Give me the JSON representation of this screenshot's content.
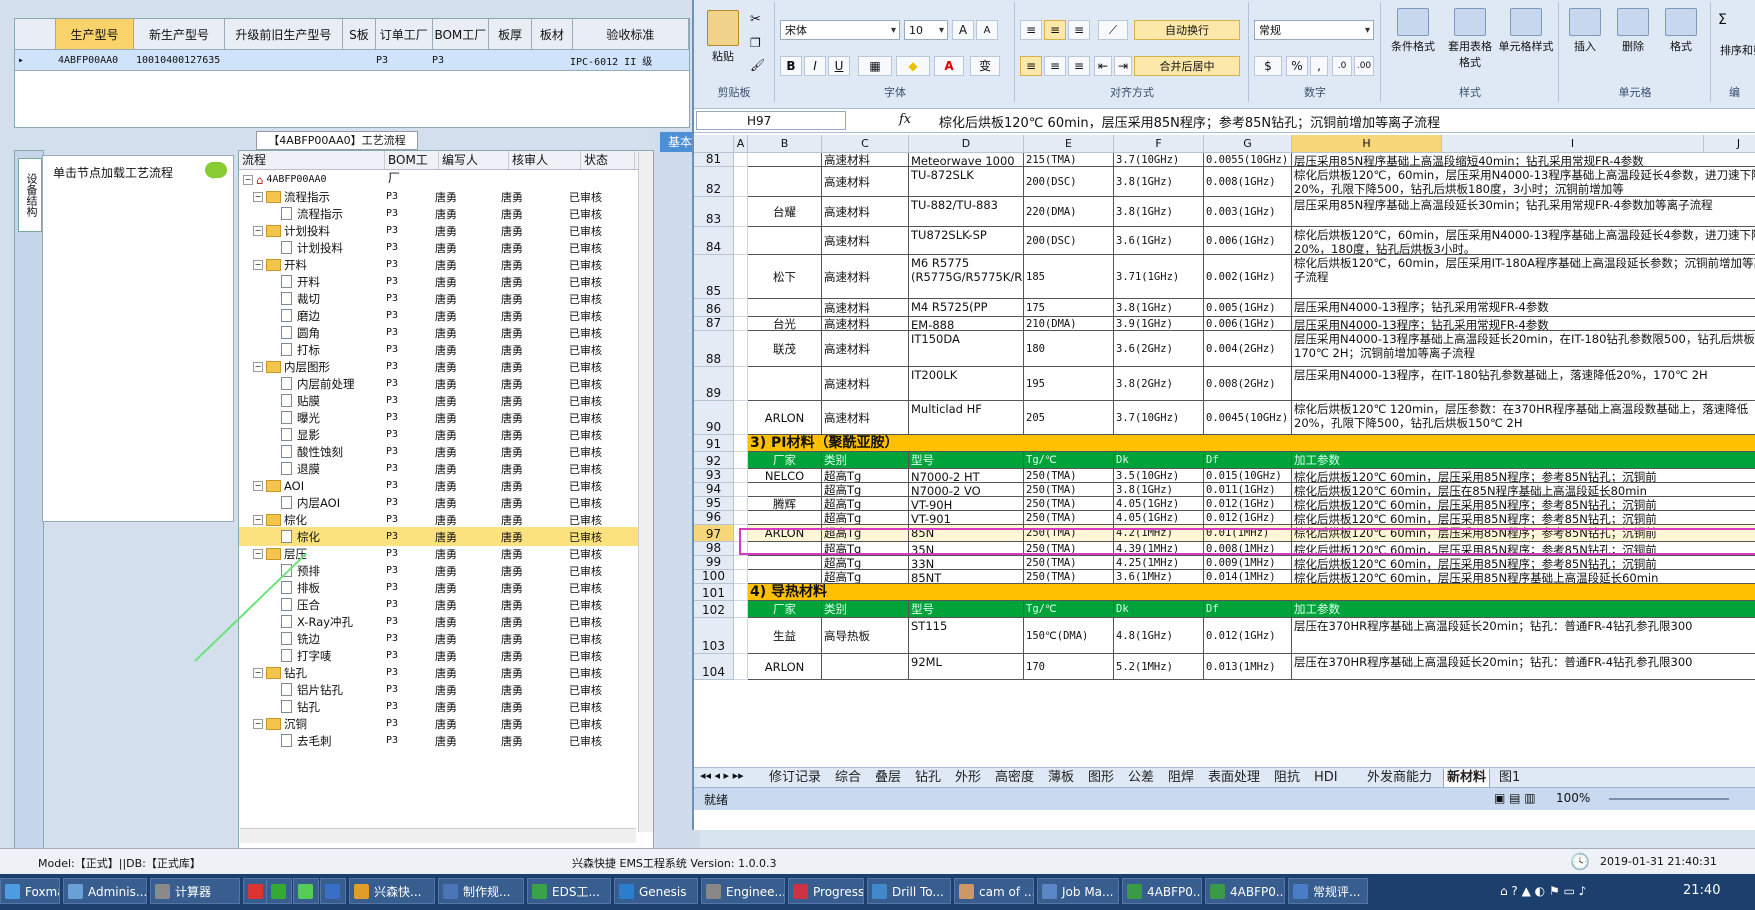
{
  "left": {
    "top_grid": {
      "headers": [
        "生产型号",
        "新生产型号",
        "升级前旧生产型号",
        "S板",
        "订单工厂",
        "BOM工厂",
        "板厚",
        "板材",
        "验收标准"
      ],
      "row": [
        "4ABFP00AA0",
        "10010400127635",
        "",
        "",
        "P3",
        "P3",
        "",
        "",
        "IPC-6012 II 级"
      ]
    },
    "side_tab": "设备结构",
    "load_hint": "单击节点加载工艺流程",
    "tree_caption": "【4ABFP00AA0】工艺流程",
    "tree_headers": [
      "流程",
      "BOM工厂",
      "编写人",
      "核审人",
      "状态"
    ],
    "tree_root": "4ABFP00AA0",
    "tree_rows": [
      {
        "name": "流程指示",
        "folder": true,
        "bom": "P3",
        "writer": "唐勇",
        "reviewer": "唐勇",
        "status": "已审核"
      },
      {
        "name": "流程指示",
        "folder": false,
        "bom": "P3",
        "writer": "唐勇",
        "reviewer": "唐勇",
        "status": "已审核"
      },
      {
        "name": "计划投料",
        "folder": true,
        "bom": "P3",
        "writer": "唐勇",
        "reviewer": "唐勇",
        "status": "已审核"
      },
      {
        "name": "计划投料",
        "folder": false,
        "bom": "P3",
        "writer": "唐勇",
        "reviewer": "唐勇",
        "status": "已审核"
      },
      {
        "name": "开料",
        "folder": true,
        "bom": "P3",
        "writer": "唐勇",
        "reviewer": "唐勇",
        "status": "已审核"
      },
      {
        "name": "开料",
        "folder": false,
        "bom": "P3",
        "writer": "唐勇",
        "reviewer": "唐勇",
        "status": "已审核"
      },
      {
        "name": "裁切",
        "folder": false,
        "bom": "P3",
        "writer": "唐勇",
        "reviewer": "唐勇",
        "status": "已审核"
      },
      {
        "name": "磨边",
        "folder": false,
        "bom": "P3",
        "writer": "唐勇",
        "reviewer": "唐勇",
        "status": "已审核"
      },
      {
        "name": "圆角",
        "folder": false,
        "bom": "P3",
        "writer": "唐勇",
        "reviewer": "唐勇",
        "status": "已审核"
      },
      {
        "name": "打标",
        "folder": false,
        "bom": "P3",
        "writer": "唐勇",
        "reviewer": "唐勇",
        "status": "已审核"
      },
      {
        "name": "内层图形",
        "folder": true,
        "bom": "P3",
        "writer": "唐勇",
        "reviewer": "唐勇",
        "status": "已审核"
      },
      {
        "name": "内层前处理",
        "folder": false,
        "bom": "P3",
        "writer": "唐勇",
        "reviewer": "唐勇",
        "status": "已审核"
      },
      {
        "name": "贴膜",
        "folder": false,
        "bom": "P3",
        "writer": "唐勇",
        "reviewer": "唐勇",
        "status": "已审核"
      },
      {
        "name": "曝光",
        "folder": false,
        "bom": "P3",
        "writer": "唐勇",
        "reviewer": "唐勇",
        "status": "已审核"
      },
      {
        "name": "显影",
        "folder": false,
        "bom": "P3",
        "writer": "唐勇",
        "reviewer": "唐勇",
        "status": "已审核"
      },
      {
        "name": "酸性蚀刻",
        "folder": false,
        "bom": "P3",
        "writer": "唐勇",
        "reviewer": "唐勇",
        "status": "已审核"
      },
      {
        "name": "退膜",
        "folder": false,
        "bom": "P3",
        "writer": "唐勇",
        "reviewer": "唐勇",
        "status": "已审核"
      },
      {
        "name": "AOI",
        "folder": true,
        "bom": "P3",
        "writer": "唐勇",
        "reviewer": "唐勇",
        "status": "已审核"
      },
      {
        "name": "内层AOI",
        "folder": false,
        "bom": "P3",
        "writer": "唐勇",
        "reviewer": "唐勇",
        "status": "已审核"
      },
      {
        "name": "棕化",
        "folder": true,
        "bom": "P3",
        "writer": "唐勇",
        "reviewer": "唐勇",
        "status": "已审核"
      },
      {
        "name": "棕化",
        "folder": false,
        "bom": "P3",
        "writer": "唐勇",
        "reviewer": "唐勇",
        "status": "已审核",
        "selected": true
      },
      {
        "name": "层压",
        "folder": true,
        "bom": "P3",
        "writer": "唐勇",
        "reviewer": "唐勇",
        "status": "已审核"
      },
      {
        "name": "预排",
        "folder": false,
        "bom": "P3",
        "writer": "唐勇",
        "reviewer": "唐勇",
        "status": "已审核"
      },
      {
        "name": "排板",
        "folder": false,
        "bom": "P3",
        "writer": "唐勇",
        "reviewer": "唐勇",
        "status": "已审核"
      },
      {
        "name": "压合",
        "folder": false,
        "bom": "P3",
        "writer": "唐勇",
        "reviewer": "唐勇",
        "status": "已审核"
      },
      {
        "name": "X-Ray冲孔",
        "folder": false,
        "bom": "P3",
        "writer": "唐勇",
        "reviewer": "唐勇",
        "status": "已审核"
      },
      {
        "name": "铣边",
        "folder": false,
        "bom": "P3",
        "writer": "唐勇",
        "reviewer": "唐勇",
        "status": "已审核"
      },
      {
        "name": "打字唛",
        "folder": false,
        "bom": "P3",
        "writer": "唐勇",
        "reviewer": "唐勇",
        "status": "已审核"
      },
      {
        "name": "钻孔",
        "folder": true,
        "bom": "P3",
        "writer": "唐勇",
        "reviewer": "唐勇",
        "status": "已审核"
      },
      {
        "name": "铝片钻孔",
        "folder": false,
        "bom": "P3",
        "writer": "唐勇",
        "reviewer": "唐勇",
        "status": "已审核"
      },
      {
        "name": "钻孔",
        "folder": false,
        "bom": "P3",
        "writer": "唐勇",
        "reviewer": "唐勇",
        "status": "已审核"
      },
      {
        "name": "沉铜",
        "folder": true,
        "bom": "P3",
        "writer": "唐勇",
        "reviewer": "唐勇",
        "status": "已审核"
      },
      {
        "name": "去毛刺",
        "folder": false,
        "bom": "P3",
        "writer": "唐勇",
        "reviewer": "唐勇",
        "status": "已审核"
      }
    ],
    "basic_tab": "基本",
    "status_left": "Model:【正式】||DB:【正式库】",
    "status_center": "兴森快捷 EMS工程系统 Version: 1.0.0.3",
    "status_time": "2019-01-31 21:40:31"
  },
  "excel": {
    "font_name": "宋体",
    "font_size": "10",
    "number_format": "常规",
    "buttons": {
      "paste": "粘贴",
      "wrap": "自动换行",
      "merge": "合并后居中",
      "cond": "条件格式",
      "table": "套用表格格式",
      "style": "单元格样式",
      "insert": "插入",
      "delete": "删除",
      "format": "格式",
      "sort": "排序和筛选"
    },
    "group_labels": [
      "剪贴板",
      "字体",
      "对齐方式",
      "数字",
      "样式",
      "单元格",
      "编"
    ],
    "name_box": "H97",
    "fx": "fx",
    "formula": "棕化后烘板120℃ 60min，层压采用85N程序；参考85N钻孔；沉铜前增加等离子流程",
    "columns": [
      "A",
      "B",
      "C",
      "D",
      "E",
      "F",
      "G",
      "H",
      "I",
      "J"
    ],
    "rows": [
      {
        "num": "81",
        "maker": "",
        "type": "高速材料",
        "model": "Meteorwave 1000",
        "tg": "215(TMA)",
        "dk": "3.7(10GHz)",
        "df": "0.0055(10GHz)",
        "proc": "层压采用85N程序基础上高温段缩短40min；钻孔采用常规FR-4参数"
      },
      {
        "num": "82",
        "maker": "",
        "type": "高速材料",
        "model": "TU-872SLK",
        "tg": "200(DSC)",
        "dk": "3.8(1GHz)",
        "df": "0.008(1GHz)",
        "proc": "棕化后烘板120℃，60min，层压采用N4000-13程序基础上高温段延长4参数，进刀速下降20%，孔限下降500，钻孔后烘板180度，3小时；沉铜前增加等"
      },
      {
        "num": "83",
        "maker": "台耀",
        "type": "高速材料",
        "model": "TU-882/TU-883",
        "tg": "220(DMA)",
        "dk": "3.8(1GHz)",
        "df": "0.003(1GHz)",
        "proc": "层压采用85N程序基础上高温段延长30min；钻孔采用常规FR-4参数加等离子流程"
      },
      {
        "num": "84",
        "maker": "",
        "type": "高速材料",
        "model": "TU872SLK-SP",
        "tg": "200(DSC)",
        "dk": "3.6(1GHz)",
        "df": "0.006(1GHz)",
        "proc": "棕化后烘板120℃，60min，层压采用N4000-13程序基础上高温段延长4参数，进刀速下降20%，180度，钻孔后烘板3小时。"
      },
      {
        "num": "85",
        "maker": "松下",
        "type": "高速材料",
        "model": "M6 R5775 (R5775G/R5775K/R5775NE)",
        "tg": "185",
        "dk": "3.71(1GHz)",
        "df": "0.002(1GHz)",
        "proc": "棕化后烘板120℃，60min，层压采用IT-180A程序基础上高温段延长参数；沉铜前增加等离子流程"
      },
      {
        "num": "86",
        "maker": "",
        "type": "高速材料",
        "model": "M4 R5725(PP R5620)",
        "tg": "175",
        "dk": "3.8(1GHz)",
        "df": "0.005(1GHz)",
        "proc": "层压采用N4000-13程序；钻孔采用常规FR-4参数"
      },
      {
        "num": "87",
        "maker": "台光",
        "type": "高速材料",
        "model": "EM-888",
        "tg": "210(DMA)",
        "dk": "3.9(1GHz)",
        "df": "0.006(1GHz)",
        "proc": "层压采用N4000-13程序；钻孔采用常规FR-4参数"
      },
      {
        "num": "88",
        "maker": "联茂",
        "type": "高速材料",
        "model": "IT150DA",
        "tg": "180",
        "dk": "3.6(2GHz)",
        "df": "0.004(2GHz)",
        "proc": "层压采用N4000-13程序基础上高温段延长20min，在IT-180钻孔参数限500，钻孔后烘板170℃ 2H；沉铜前增加等离子流程"
      },
      {
        "num": "89",
        "maker": "",
        "type": "高速材料",
        "model": "IT200LK",
        "tg": "195",
        "dk": "3.8(2GHz)",
        "df": "0.008(2GHz)",
        "proc": "层压采用N4000-13程序，在IT-180钻孔参数基础上，落速降低20%，170℃ 2H"
      },
      {
        "num": "90",
        "maker": "ARLON",
        "type": "高速材料",
        "model": "Multiclad HF",
        "tg": "205",
        "dk": "3.7(10GHz)",
        "df": "0.0045(10GHz)",
        "proc": "棕化后烘板120℃ 120min，层压参数：在370HR程序基础上高温段数基础上，落速降低20%，孔限下降500，钻孔后烘板150℃ 2H"
      },
      {
        "num": "91",
        "section": "3) PI材料（聚酰亚胺）"
      },
      {
        "num": "92",
        "header": true,
        "maker": "厂家",
        "type": "类别",
        "model": "型号",
        "tg": "Tg/℃",
        "dk": "Dk",
        "df": "Df",
        "proc": "加工参数"
      },
      {
        "num": "93",
        "maker": "NELCO",
        "type": "超高Tg",
        "model": "N7000-2 HT",
        "tg": "250(TMA)",
        "dk": "3.5(10GHz)",
        "df": "0.015(10GHz)",
        "proc": "棕化后烘板120℃ 60min，层压采用85N程序；参考85N钻孔；沉铜前"
      },
      {
        "num": "94",
        "maker": "",
        "type": "超高Tg",
        "model": "N7000-2 VO",
        "tg": "250(TMA)",
        "dk": "3.8(1GHz)",
        "df": "0.011(1GHz)",
        "proc": "棕化后烘板120℃ 60min，层压在85N程序基础上高温段延长80min"
      },
      {
        "num": "95",
        "maker": "腾辉",
        "type": "超高Tg",
        "model": "VT-90H",
        "tg": "250(TMA)",
        "dk": "4.05(1GHz)",
        "df": "0.012(1GHz)",
        "proc": "棕化后烘板120℃ 60min，层压采用85N程序；参考85N钻孔；沉铜前"
      },
      {
        "num": "96",
        "maker": "",
        "type": "超高Tg",
        "model": "VT-901",
        "tg": "250(TMA)",
        "dk": "4.05(1GHz)",
        "df": "0.012(1GHz)",
        "proc": "棕化后烘板120℃ 60min，层压采用85N程序；参考85N钻孔；沉铜前"
      },
      {
        "num": "97",
        "maker": "ARLON",
        "type": "超高Tg",
        "model": "85N",
        "tg": "250(TMA)",
        "dk": "4.2(1MHz)",
        "df": "0.01(1MHz)",
        "proc": "棕化后烘板120℃ 60min，层压采用85N程序；参考85N钻孔；沉铜前",
        "active": true
      },
      {
        "num": "98",
        "maker": "",
        "type": "超高Tg",
        "model": "35N",
        "tg": "250(TMA)",
        "dk": "4.39(1MHz)",
        "df": "0.008(1MHz)",
        "proc": "棕化后烘板120℃ 60min，层压采用85N程序；参考85N钻孔；沉铜前"
      },
      {
        "num": "99",
        "maker": "",
        "type": "超高Tg",
        "model": "33N",
        "tg": "250(TMA)",
        "dk": "4.25(1MHz)",
        "df": "0.009(1MHz)",
        "proc": "棕化后烘板120℃ 60min，层压采用85N程序；参考85N钻孔；沉铜前"
      },
      {
        "num": "100",
        "maker": "",
        "type": "超高Tg",
        "model": "85NT",
        "tg": "250(TMA)",
        "dk": "3.6(1MHz)",
        "df": "0.014(1MHz)",
        "proc": "棕化后烘板120℃ 60min，层压采用85N程序基础上高温段延长60min"
      },
      {
        "num": "101",
        "section": "4) 导热材料"
      },
      {
        "num": "102",
        "header": true,
        "maker": "厂家",
        "type": "类别",
        "model": "型号",
        "tg": "Tg/℃",
        "dk": "Dk",
        "df": "Df",
        "proc": "加工参数"
      },
      {
        "num": "103",
        "maker": "生益",
        "type": "高导热板",
        "model": "ST115",
        "tg": "150℃(DMA)",
        "dk": "4.8(1GHz)",
        "df": "0.012(1GHz)",
        "proc": "层压在370HR程序基础上高温段延长20min；钻孔：普通FR-4钻孔参孔限300"
      },
      {
        "num": "104",
        "maker": "ARLON",
        "type": "",
        "model": "92ML",
        "tg": "170",
        "dk": "5.2(1MHz)",
        "df": "0.013(1MHz)",
        "proc": "层压在370HR程序基础上高温段延长20min；钻孔：普通FR-4钻孔参孔限300"
      }
    ],
    "sheet_tabs": [
      "修订记录",
      "综合",
      "叠层",
      "钻孔",
      "外形",
      "高密度",
      "薄板",
      "图形",
      "公差",
      "阻焊",
      "表面处理",
      "阻抗",
      "HDI",
      "外发商能力",
      "新材料",
      "图1"
    ],
    "active_tab": "新材料",
    "status_ready": "就绪",
    "zoom": "100%"
  },
  "taskbar": {
    "items": [
      "Foxmail",
      "Adminis...",
      "计算器",
      "",
      "",
      "",
      "",
      "兴森快...",
      "制作规...",
      "EDS工...",
      "Genesis",
      "Enginee...",
      "Progress",
      "Drill To...",
      "cam of ...",
      "Job Ma...",
      "4ABFP0...",
      "4ABFP0...",
      "常规评..."
    ],
    "clock": "21:40"
  },
  "colors": {
    "yellow": "#ffc000",
    "green": "#00a23a",
    "selected": "#fbe27e",
    "highlight": "#d63ac3"
  }
}
